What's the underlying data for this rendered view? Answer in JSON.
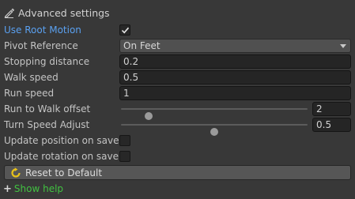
{
  "header": {
    "title": "Advanced settings",
    "icon": "pencil-icon"
  },
  "rows": {
    "use_root_motion": {
      "label": "Use Root Motion",
      "checked": true
    },
    "pivot_reference": {
      "label": "Pivot Reference",
      "value": "On Feet"
    },
    "stopping_distance": {
      "label": "Stopping distance",
      "value": "0.2"
    },
    "walk_speed": {
      "label": "Walk speed",
      "value": "0.5"
    },
    "run_speed": {
      "label": "Run speed",
      "value": "1"
    },
    "run_to_walk_offset": {
      "label": "Run to Walk offset",
      "value": "2",
      "slider_fraction": 0.15
    },
    "turn_speed_adjust": {
      "label": "Turn Speed Adjust",
      "value": "0.5",
      "slider_fraction": 0.5
    },
    "update_position_on_save": {
      "label": "Update position on save",
      "checked": false
    },
    "update_rotation_on_save": {
      "label": "Update rotation on save",
      "checked": false
    }
  },
  "reset_button": {
    "label": "Reset to Default",
    "icon": "refresh-icon",
    "icon_color": "#e8c21a"
  },
  "help": {
    "plus": "+",
    "label": "Show help",
    "color": "#41c241"
  },
  "colors": {
    "accent_label": "#5aa0f0",
    "background": "#383838"
  }
}
